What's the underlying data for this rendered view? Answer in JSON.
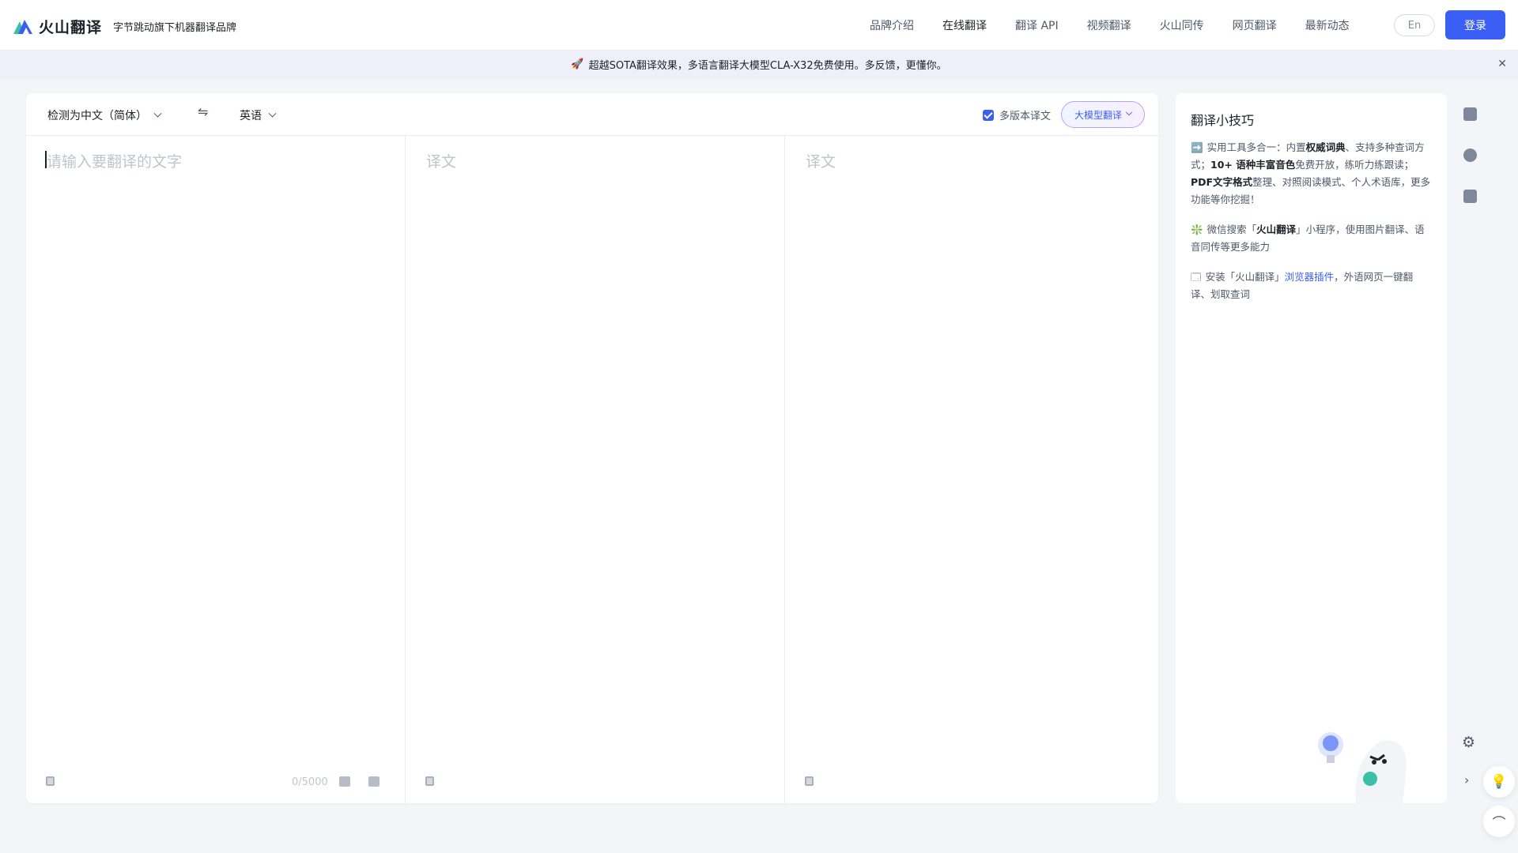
{
  "header": {
    "brand_name": "火山翻译",
    "brand_sub": "字节跳动旗下机器翻译品牌",
    "nav": [
      {
        "label": "品牌介绍"
      },
      {
        "label": "在线翻译"
      },
      {
        "label": "翻译 API"
      },
      {
        "label": "视频翻译"
      },
      {
        "label": "火山同传"
      },
      {
        "label": "网页翻译"
      },
      {
        "label": "最新动态"
      }
    ],
    "lang_toggle": "En",
    "login_label": "登录"
  },
  "banner": {
    "text": "超越SOTA翻译效果，多语言翻译大模型CLA-X32免费使用。多反馈，更懂你。",
    "close_glyph": "✕"
  },
  "translator": {
    "source_lang": "检测为中文（简体）",
    "target_lang": "英语",
    "multi_version_label": "多版本译文",
    "multi_version_checked": true,
    "model_label": "大模型翻译",
    "input_placeholder": "请输入要翻译的文字",
    "output_placeholder_1": "译文",
    "output_placeholder_2": "译文",
    "char_count": "0/5000"
  },
  "tips": {
    "title": "翻译小技巧",
    "items": [
      {
        "icon": "➡️",
        "text_a": "实用工具多合一：内置",
        "bold_a": "权威词典",
        "text_b": "、支持多种查词方式；",
        "bold_b": "10+ 语种丰富音色",
        "text_c": "免费开放，练听力练跟读；",
        "bold_c": "PDF文字格式",
        "text_d": "整理、对照阅读模式、个人术语库，更多功能等你挖掘！"
      },
      {
        "icon": "❇️",
        "text_a": "微信搜索「",
        "bold_a": "火山翻译",
        "text_b": "」小程序，使用图片翻译、语音同传等更多能力"
      },
      {
        "icon": "🗔",
        "text_a": "安装「火山翻译」",
        "link": "浏览器插件",
        "text_b": "，外语网页一键翻译、划取查词"
      }
    ]
  },
  "colors": {
    "accent": "#3b5ff5",
    "background": "#f4f5f9"
  }
}
